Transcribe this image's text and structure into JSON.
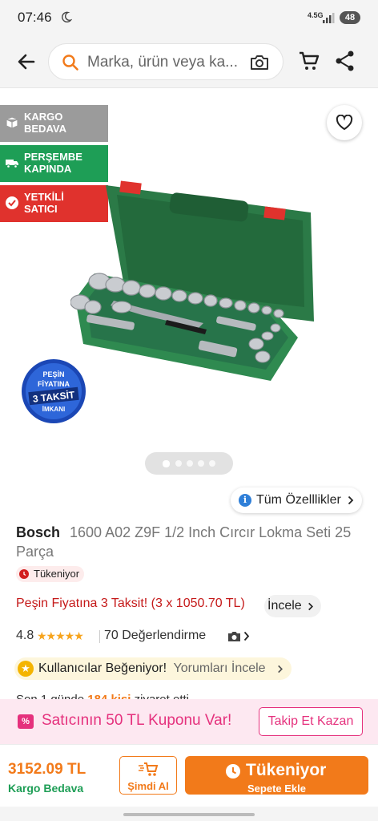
{
  "status_bar": {
    "time": "07:46",
    "network": "4.5G",
    "battery": "48"
  },
  "header": {
    "search_placeholder": "Marka, ürün veya ka..."
  },
  "gallery": {
    "badges": [
      {
        "line1": "KARGO",
        "line2": "BEDAVA"
      },
      {
        "line1": "PERŞEMBE",
        "line2": "KAPINDA"
      },
      {
        "line1": "YETKİLİ",
        "line2": "SATICI"
      }
    ],
    "sticker": {
      "line1": "PEŞİN",
      "line2": "FİYATINA",
      "line3": "3 TAKSİT",
      "line4": "İMKANI"
    },
    "image_count": 5,
    "active_image": 1
  },
  "product": {
    "all_props_label": "Tüm Özelllikler",
    "brand": "Bosch",
    "name": "1600 A02 Z9F 1/2 Inch Cırcır Lokma Seti 25 Parça",
    "stock_label": "Tükeniyor",
    "installment_text": "Peşin Fiyatına 3 Taksit! (3 x 1050.70 TL)",
    "installment_link": "İncele",
    "rating": "4.8",
    "stars": "★★★★★",
    "review_count": "70 Değerlendirme",
    "likes_label": "Kullanıcılar Beğeniyor!",
    "likes_link": "Yorumları İncele",
    "partial_prefix": "Son 1 günde ",
    "partial_highlight": "184 kişi",
    "partial_suffix": " ziyaret etti"
  },
  "coupon": {
    "icon": "%",
    "text": "Satıcının 50 TL Kuponu Var!",
    "button": "Takip Et Kazan"
  },
  "bottom": {
    "price": "3152.09 TL",
    "shipping": "Kargo Bedava",
    "buy_now": "Şimdi Al",
    "add_main": "Tükeniyor",
    "add_sub": "Sepete Ekle"
  },
  "colors": {
    "accent": "#f27a1a",
    "green": "#1e9e56",
    "red": "#e0322d",
    "pink": "#e5317d"
  },
  "icons": [
    "moon-icon",
    "signal-icon",
    "back-arrow-icon",
    "search-icon",
    "camera-icon",
    "cart-icon",
    "share-icon",
    "box-icon",
    "truck-icon",
    "verified-icon",
    "heart-icon",
    "info-icon",
    "clock-icon",
    "star-icon"
  ]
}
